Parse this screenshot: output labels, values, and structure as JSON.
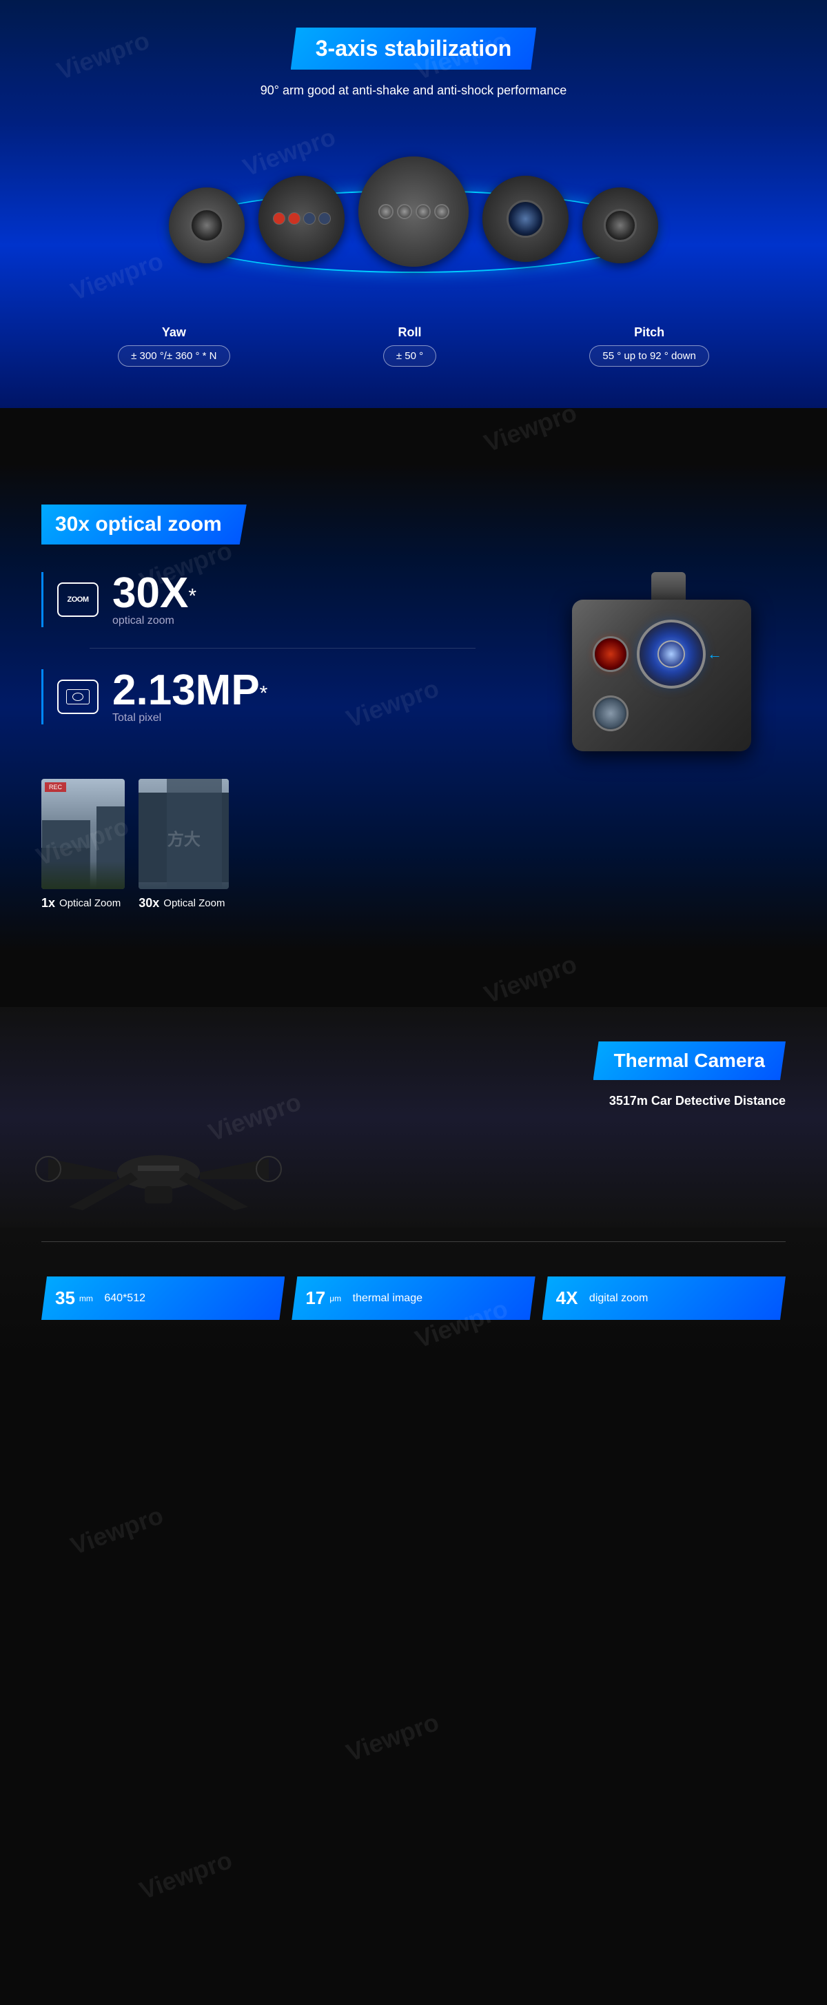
{
  "watermark": "Viewpro",
  "section1": {
    "title": "3-axis stabilization",
    "subtitle": "90° arm good at anti-shake and anti-shock performance",
    "specs": [
      {
        "label": "Yaw",
        "value": "± 300 °/± 360 ° * N"
      },
      {
        "label": "Roll",
        "value": "± 50 °"
      },
      {
        "label": "Pitch",
        "value": "55 ° up to 92 ° down"
      }
    ]
  },
  "section2": {
    "title": "30x optical zoom",
    "zoom_value": "30X",
    "zoom_star": "*",
    "zoom_label": "optical zoom",
    "zoom_icon_text": "ZOOM",
    "mp_value": "2.13MP",
    "mp_star": "*",
    "mp_label": "Total pixel",
    "compare": [
      {
        "multiplier": "1x",
        "label": "Optical Zoom"
      },
      {
        "multiplier": "30x",
        "label": "Optical Zoom"
      }
    ]
  },
  "section3": {
    "title": "Thermal Camera",
    "subtitle": "3517m Car Detective Distance",
    "chips": [
      {
        "value": "35",
        "unit": "mm",
        "detail": "640*512"
      },
      {
        "value": "17",
        "unit": "μm",
        "detail": "thermal image"
      },
      {
        "value": "4X",
        "unit": "",
        "detail": "digital zoom"
      }
    ]
  }
}
